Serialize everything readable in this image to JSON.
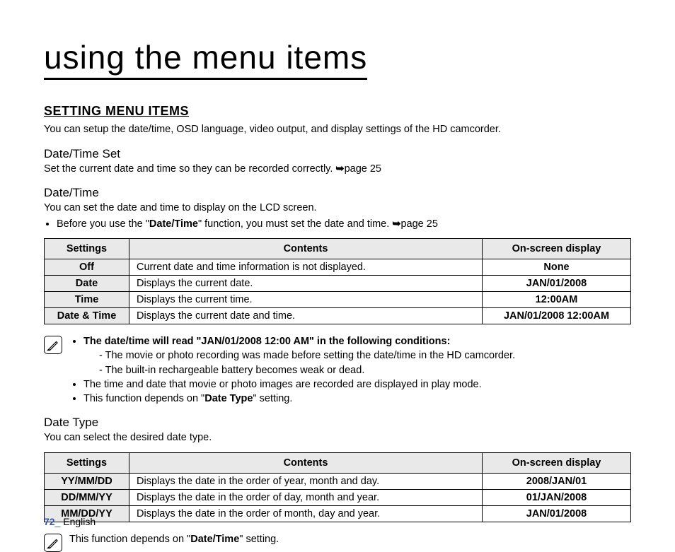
{
  "chapter": "using the menu items",
  "section": {
    "title": "SETTING MENU ITEMS",
    "intro": "You can setup the date/time, OSD language, video output, and display settings of the HD camcorder."
  },
  "dateTimeSet": {
    "heading": "Date/Time Set",
    "desc_prefix": "Set the current date and time so they can be recorded correctly. ",
    "page_ref": "page 25"
  },
  "dateTime": {
    "heading": "Date/Time",
    "desc": "You can set the date and time to display on the LCD screen.",
    "bullet_before": "Before you use the \"",
    "bullet_bold": "Date/Time",
    "bullet_after": "\" function, you must set the date and time. ",
    "page_ref": "page 25"
  },
  "table1": {
    "headers": {
      "settings": "Settings",
      "contents": "Contents",
      "display": "On-screen display"
    },
    "rows": [
      {
        "setting": "Off",
        "content": "Current date and time information is not displayed.",
        "display": "None"
      },
      {
        "setting": "Date",
        "content": "Displays the current date.",
        "display": "JAN/01/2008"
      },
      {
        "setting": "Time",
        "content": "Displays the current time.",
        "display": "12:00AM"
      },
      {
        "setting": "Date & Time",
        "content": "Displays the current date and time.",
        "display": "JAN/01/2008 12:00AM"
      }
    ]
  },
  "note1": {
    "line1": "The date/time will read \"JAN/01/2008 12:00 AM\" in the following conditions:",
    "dash1": "The movie or photo recording was made before setting the date/time in the HD camcorder.",
    "dash2": "The built-in rechargeable battery becomes weak or dead.",
    "line2": "The time and date that movie or photo images are recorded are displayed in play mode.",
    "line3_before": "This function depends on \"",
    "line3_bold": "Date Type",
    "line3_after": "\" setting."
  },
  "dateType": {
    "heading": "Date Type",
    "desc": "You can select the desired date type."
  },
  "table2": {
    "headers": {
      "settings": "Settings",
      "contents": "Contents",
      "display": "On-screen display"
    },
    "rows": [
      {
        "setting": "YY/MM/DD",
        "content": "Displays the date in the order of year, month and day.",
        "display": "2008/JAN/01"
      },
      {
        "setting": "DD/MM/YY",
        "content": "Displays the date in the order of day, month and year.",
        "display": "01/JAN/2008"
      },
      {
        "setting": "MM/DD/YY",
        "content": "Displays the date in the order of month, day and year.",
        "display": "JAN/01/2008"
      }
    ]
  },
  "note2": {
    "before": "This function depends on \"",
    "bold": "Date/Time",
    "after": "\" setting."
  },
  "footer": {
    "page": "72",
    "lang": "English"
  }
}
